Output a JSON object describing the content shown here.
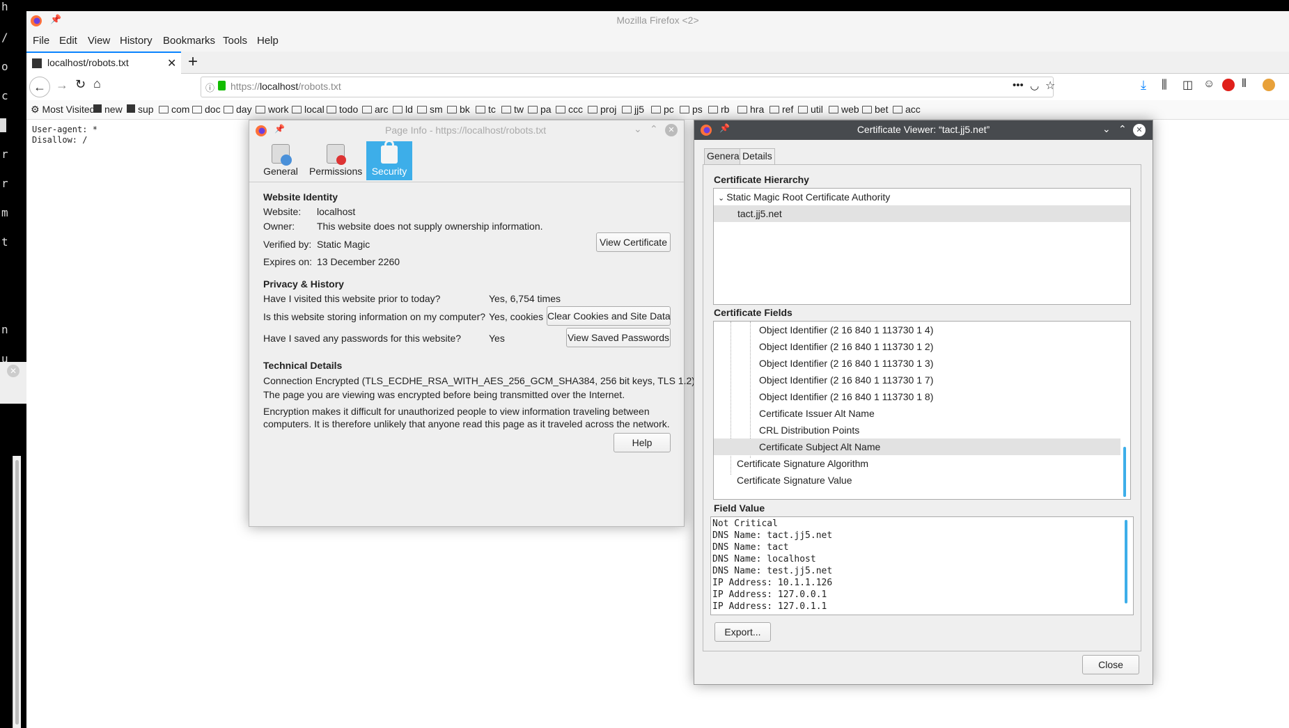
{
  "terminal": {
    "chars": [
      "h",
      "/",
      "o",
      "c",
      "r",
      "r",
      "m",
      "t",
      "n",
      "u"
    ]
  },
  "firefox": {
    "window_title": "Mozilla Firefox <2>",
    "menu": [
      "File",
      "Edit",
      "View",
      "History",
      "Bookmarks",
      "Tools",
      "Help"
    ],
    "tab_title": "localhost/robots.txt",
    "url_prefix": "https://",
    "url_host": "localhost",
    "url_path": "/robots.txt",
    "bookmarks": [
      "Most Visited",
      "new",
      "sup",
      "com",
      "doc",
      "day",
      "work",
      "local",
      "todo",
      "arc",
      "ld",
      "sm",
      "bk",
      "tc",
      "tw",
      "pa",
      "ccc",
      "proj",
      "jj5",
      "pc",
      "ps",
      "rb",
      "hra",
      "ref",
      "util",
      "web",
      "bet",
      "acc"
    ],
    "content_lines": [
      "User-agent: *",
      "Disallow: /"
    ]
  },
  "page_info": {
    "title": "Page Info - https://localhost/robots.txt",
    "tabs": [
      "General",
      "Permissions",
      "Security"
    ],
    "identity_heading": "Website Identity",
    "website_label": "Website:",
    "website_value": "localhost",
    "owner_label": "Owner:",
    "owner_value": "This website does not supply ownership information.",
    "verified_label": "Verified by:",
    "verified_value": "Static Magic",
    "expires_label": "Expires on:",
    "expires_value": "13 December 2260",
    "view_cert_button": "View Certificate",
    "privacy_heading": "Privacy & History",
    "q_visited": "Have I visited this website prior to today?",
    "a_visited": "Yes, 6,754 times",
    "q_storing": "Is this website storing information on my computer?",
    "a_storing": "Yes, cookies",
    "clear_button": "Clear Cookies and Site Data",
    "q_passwords": "Have I saved any passwords for this website?",
    "a_passwords": "Yes",
    "view_passwords_button": "View Saved Passwords",
    "tech_heading": "Technical Details",
    "tech_line1": "Connection Encrypted (TLS_ECDHE_RSA_WITH_AES_256_GCM_SHA384, 256 bit keys, TLS 1.2)",
    "tech_line2": "The page you are viewing was encrypted before being transmitted over the Internet.",
    "tech_line3": "Encryption makes it difficult for unauthorized people to view information traveling between",
    "tech_line4": "computers. It is therefore unlikely that anyone read this page as it traveled across the network.",
    "help_button": "Help"
  },
  "cert_viewer": {
    "title": "Certificate Viewer: “tact.jj5.net”",
    "tab_general": "General",
    "tab_details": "Details",
    "hierarchy_heading": "Certificate Hierarchy",
    "hierarchy": [
      "Static Magic Root Certificate Authority",
      "tact.jj5.net"
    ],
    "fields_heading": "Certificate Fields",
    "fields": [
      "Object Identifier (2 16 840 1 113730 1 4)",
      "Object Identifier (2 16 840 1 113730 1 2)",
      "Object Identifier (2 16 840 1 113730 1 3)",
      "Object Identifier (2 16 840 1 113730 1 7)",
      "Object Identifier (2 16 840 1 113730 1 8)",
      "Certificate Issuer Alt Name",
      "CRL Distribution Points",
      "Certificate Subject Alt Name",
      "Certificate Signature Algorithm",
      "Certificate Signature Value"
    ],
    "value_heading": "Field Value",
    "values": [
      "Not Critical",
      "DNS Name: tact.jj5.net",
      "DNS Name: tact",
      "DNS Name: localhost",
      "DNS Name: test.jj5.net",
      "IP Address: 10.1.1.126",
      "IP Address: 127.0.0.1",
      "IP Address: 127.0.1.1"
    ],
    "export_button": "Export...",
    "close_button": "Close"
  }
}
